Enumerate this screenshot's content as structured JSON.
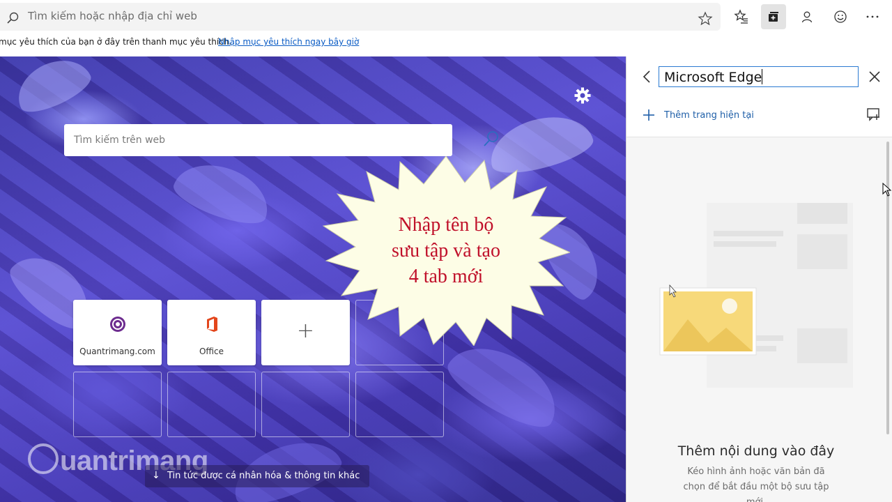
{
  "address_bar": {
    "placeholder": "Tìm kiếm hoặc nhập địa chỉ web",
    "icons": [
      "search-icon",
      "star-icon",
      "favorites-icon",
      "collections-icon",
      "profile-icon",
      "emoji-icon",
      "more-icon"
    ]
  },
  "favorites_bar": {
    "message": "mục yêu thích của bạn ở đây trên thanh mục yêu thích.",
    "link": "Nhập mục yêu thích ngay bây giờ"
  },
  "new_tab": {
    "search_placeholder": "Tìm kiếm trên web",
    "tiles": [
      {
        "label": "Quantrimang.com",
        "icon": "quantrimang-logo"
      },
      {
        "label": "Office",
        "icon": "office-logo"
      },
      {
        "label": "",
        "icon": "plus-icon"
      }
    ],
    "callout_lines": [
      "Nhập tên bộ",
      "sưu tập và tạo",
      "4 tab mới"
    ],
    "news_button": "Tin tức được cá nhân hóa & thông tin khác",
    "watermark": "uantrimang"
  },
  "collections_pane": {
    "name_value": "Microsoft Edge",
    "add_current_page": "Thêm trang hiện tại",
    "empty_title": "Thêm nội dung vào đây",
    "empty_description": "Kéo hình ảnh hoặc văn bản đã chọn để bắt đầu một bộ sưu tập mới.",
    "accent_color": "#1f5fa8"
  }
}
